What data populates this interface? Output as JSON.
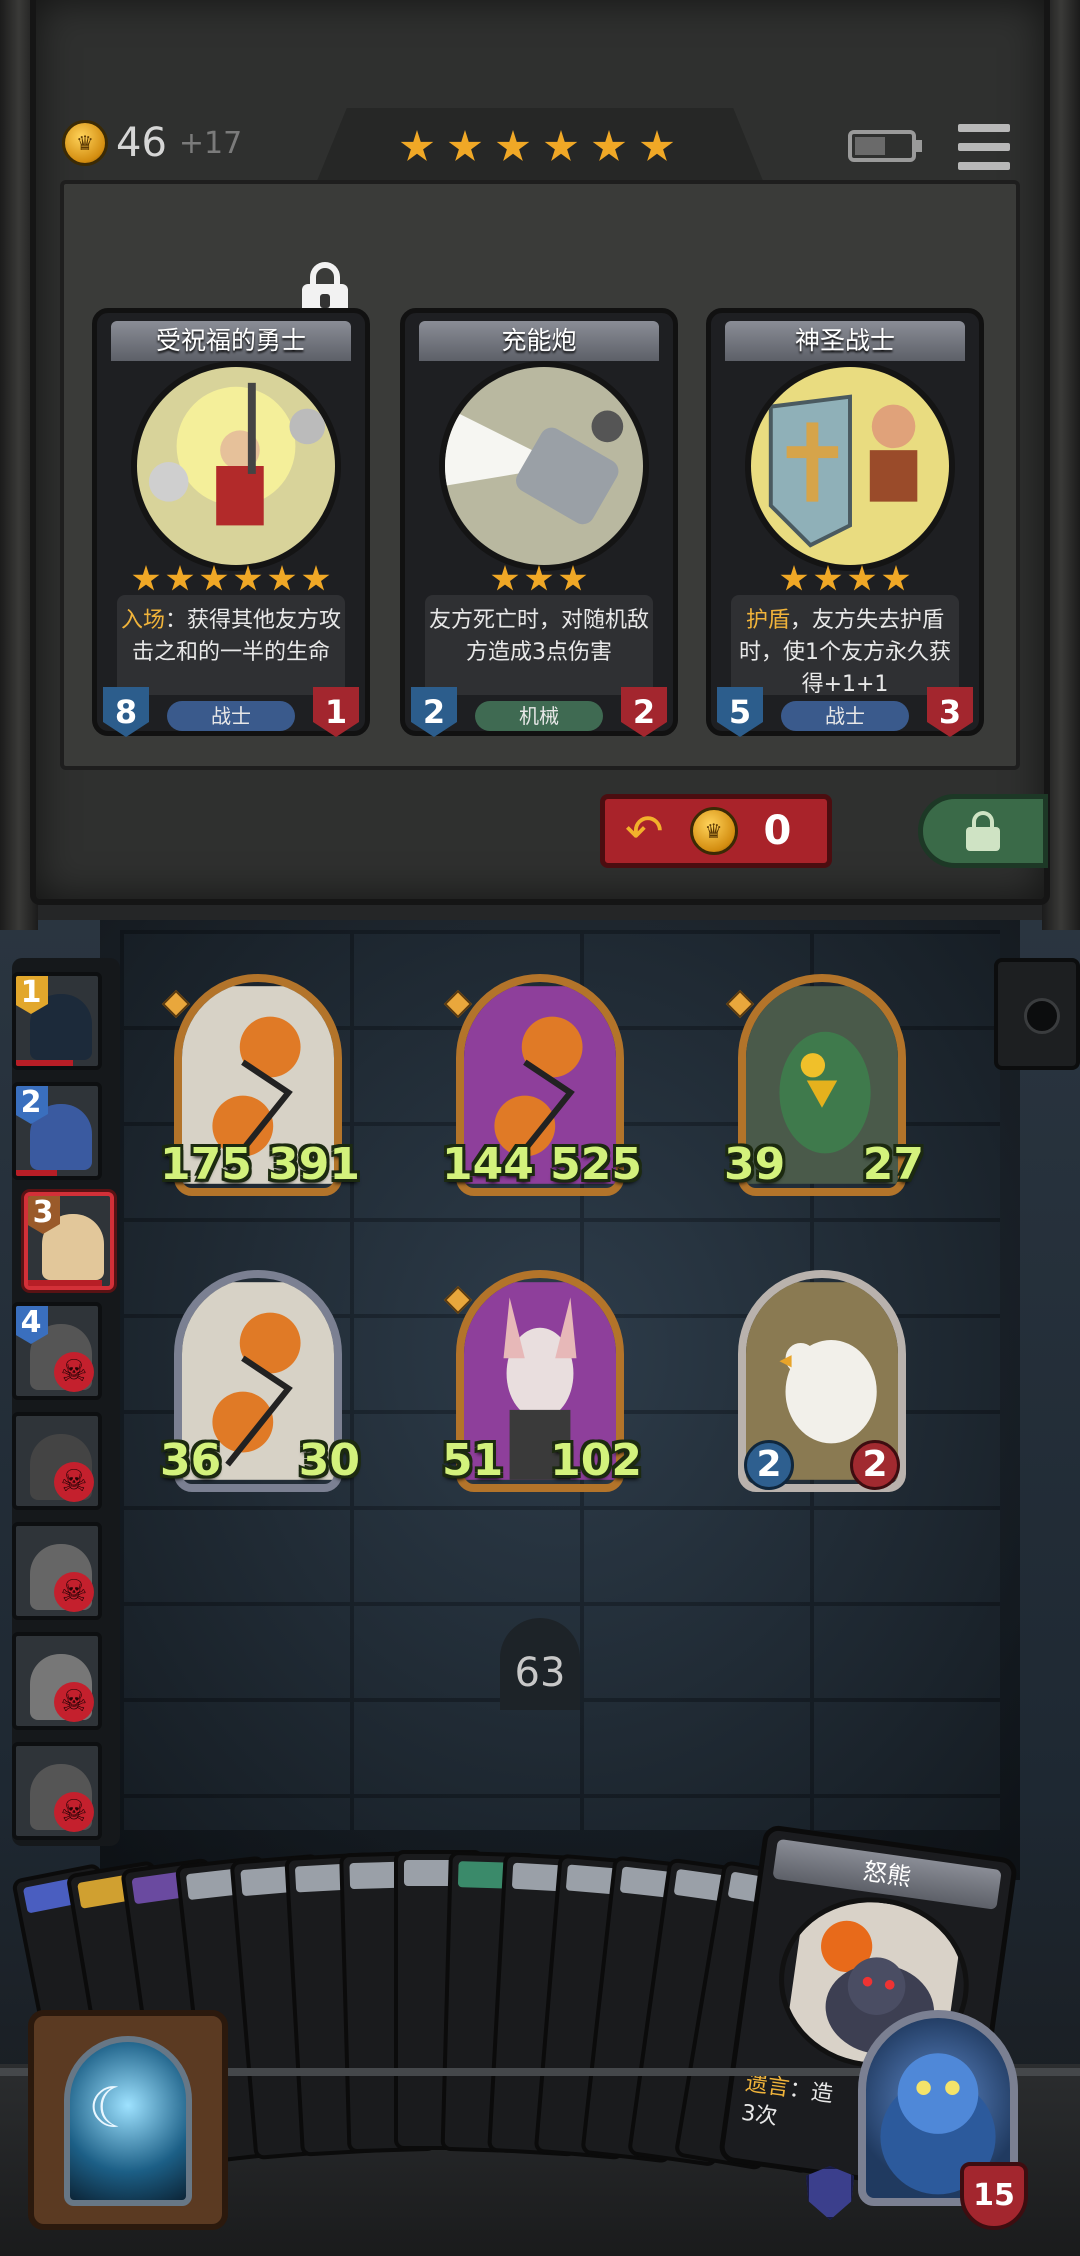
{
  "header": {
    "gold": "46",
    "gold_income": "+17",
    "tavern_stars": 6
  },
  "shop": {
    "cards": [
      {
        "name": "受祝福的勇士",
        "stars": 6,
        "desc_kw": "入场",
        "desc_text": "：获得其他友方攻击之和的一半的生命",
        "attack": "8",
        "health": "1",
        "tribe": "战士",
        "tribe_color": "#3a5a8c",
        "locked": true
      },
      {
        "name": "充能炮",
        "stars": 3,
        "desc_kw": "",
        "desc_text": "友方死亡时，对随机敌方造成3点伤害",
        "attack": "2",
        "health": "2",
        "tribe": "机械",
        "tribe_color": "#3f6a52",
        "locked": false
      },
      {
        "name": "神圣战士",
        "stars": 4,
        "desc_kw": "护盾",
        "desc_text": "，友方失去护盾时，使1个友方永久获得+1+1",
        "attack": "5",
        "health": "3",
        "tribe": "战士",
        "tribe_color": "#3a5a8c",
        "locked": false
      }
    ],
    "refresh_cost": "0"
  },
  "board": {
    "minions": [
      {
        "name": "pumpkin-minion",
        "attack": "175",
        "health": "391"
      },
      {
        "name": "pumpkin-minion-purple",
        "attack": "144",
        "health": "525"
      },
      {
        "name": "parrot-minion",
        "attack": "39",
        "health": "27"
      },
      {
        "name": "pumpkin-minion-silver",
        "attack": "36",
        "health": "30"
      },
      {
        "name": "rabbit-minion",
        "attack": "51",
        "health": "102"
      },
      {
        "name": "goose-minion",
        "attack": "2",
        "health": "2"
      }
    ],
    "turn": "63"
  },
  "opponents": [
    {
      "rank": "1",
      "eliminated": false,
      "hp": 0.7
    },
    {
      "rank": "2",
      "eliminated": false,
      "hp": 0.5
    },
    {
      "rank": "3",
      "eliminated": false,
      "hp": 0.9,
      "active": true
    },
    {
      "rank": "4",
      "eliminated": true
    },
    {
      "rank": "",
      "eliminated": true
    },
    {
      "rank": "",
      "eliminated": true
    },
    {
      "rank": "",
      "eliminated": true
    },
    {
      "rank": "",
      "eliminated": true
    }
  ],
  "hand": {
    "featured_card": {
      "name": "怒熊",
      "desc_kw": "遗言",
      "desc_text": "：造",
      "desc_line2": "3次"
    }
  },
  "player": {
    "health": "15"
  }
}
